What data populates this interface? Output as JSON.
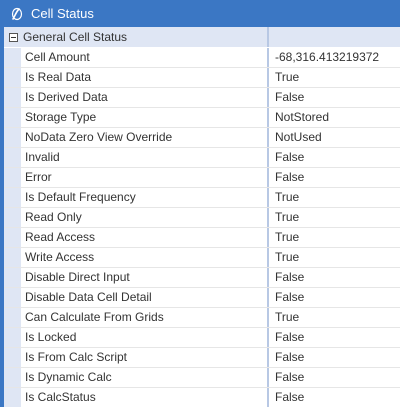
{
  "window": {
    "title": "Cell Status",
    "icon": "app-logo-icon",
    "accent": "#3b77c4"
  },
  "group": {
    "label": "General Cell Status",
    "expander": "collapse-icon"
  },
  "rows": [
    {
      "name": "Cell Amount",
      "value": "-68,316.413219372"
    },
    {
      "name": "Is Real Data",
      "value": "True"
    },
    {
      "name": "Is Derived Data",
      "value": "False"
    },
    {
      "name": "Storage Type",
      "value": "NotStored"
    },
    {
      "name": "NoData Zero View Override",
      "value": "NotUsed"
    },
    {
      "name": "Invalid",
      "value": "False"
    },
    {
      "name": "Error",
      "value": "False"
    },
    {
      "name": "Is Default Frequency",
      "value": "True"
    },
    {
      "name": "Read Only",
      "value": "True"
    },
    {
      "name": "Read Access",
      "value": "True"
    },
    {
      "name": "Write Access",
      "value": "True"
    },
    {
      "name": "Disable Direct Input",
      "value": "False"
    },
    {
      "name": "Disable Data Cell Detail",
      "value": "False"
    },
    {
      "name": "Can Calculate From Grids",
      "value": "True"
    },
    {
      "name": "Is Locked",
      "value": "False"
    },
    {
      "name": "Is From Calc Script",
      "value": "False"
    },
    {
      "name": "Is Dynamic Calc",
      "value": "False"
    },
    {
      "name": "Is CalcStatus",
      "value": "False"
    }
  ]
}
